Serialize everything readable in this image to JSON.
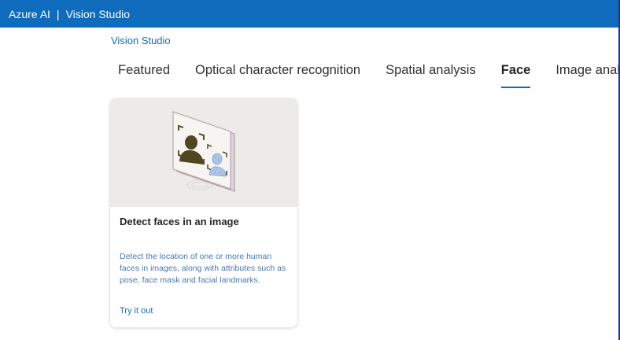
{
  "header": {
    "brand": "Azure AI",
    "separator": "|",
    "product": "Vision Studio"
  },
  "breadcrumb": {
    "label": "Vision Studio"
  },
  "tabs": [
    {
      "label": "Featured",
      "active": false
    },
    {
      "label": "Optical character recognition",
      "active": false
    },
    {
      "label": "Spatial analysis",
      "active": false
    },
    {
      "label": "Face",
      "active": true
    },
    {
      "label": "Image analysis",
      "active": false
    }
  ],
  "cards": [
    {
      "title": "Detect faces in an image",
      "description": "Detect the location of one or more human faces in images, along with attributes such as pose, face mask and facial landmarks.",
      "link_label": "Try it out",
      "illustration_icon": "face-detection-illustration-icon"
    }
  ],
  "colors": {
    "topbar": "#0f6cbd",
    "accent": "#0f6cbd",
    "card_image_bg": "#ecebe7"
  }
}
